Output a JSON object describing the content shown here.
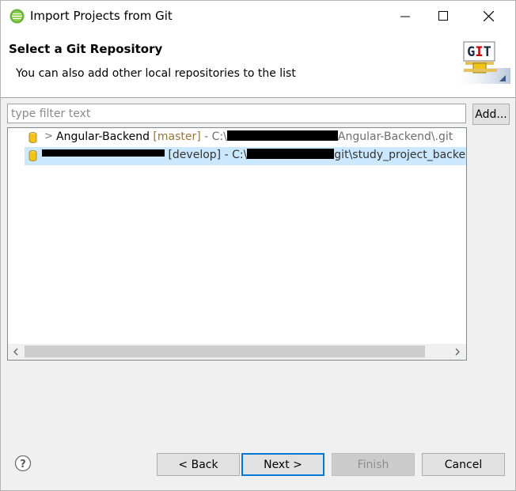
{
  "window": {
    "title": "Import Projects from Git"
  },
  "banner": {
    "title": "Select a Git Repository",
    "description": "You can also add other local repositories to the list",
    "logo_text": "GIT"
  },
  "filter": {
    "value": "",
    "placeholder": "type filter text"
  },
  "buttons": {
    "add": "Add...",
    "back": "< Back",
    "next": "Next >",
    "finish": "Finish",
    "cancel": "Cancel"
  },
  "repositories": [
    {
      "expander": ">",
      "name": "Angular-Backend",
      "branch": "[master]",
      "path_prefix": "- C:\\",
      "path_suffix": "Angular-Backend\\.git",
      "selected": false
    },
    {
      "expander": "",
      "name": "",
      "branch": "[develop]",
      "path_prefix": "- C:\\",
      "path_suffix": "git\\study_project_backen",
      "selected": true
    }
  ],
  "colors": {
    "accent": "#0078d7",
    "selection": "#cce8ff",
    "branch": "#96763b",
    "repo_icon": "#f0c419"
  },
  "icons": {
    "app": "eclipse-icon",
    "repo": "git-repository-icon",
    "help": "help-icon"
  }
}
